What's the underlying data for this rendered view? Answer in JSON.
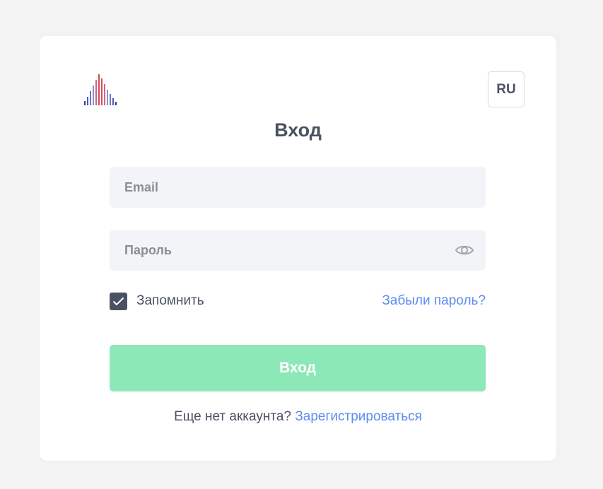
{
  "header": {
    "language": "RU",
    "title": "Вход"
  },
  "form": {
    "email": {
      "value": "",
      "placeholder": "Email"
    },
    "password": {
      "value": "",
      "placeholder": "Пароль",
      "toggle_icon": "eye-icon"
    },
    "remember": {
      "label": "Запомнить",
      "checked": true
    },
    "forgot_label": "Забыли пароль?",
    "submit_label": "Вход"
  },
  "footer": {
    "prompt": "Еще нет аккаунта?",
    "register_label": "Зарегистрироваться"
  },
  "colors": {
    "background": "#f3f3f4",
    "card": "#ffffff",
    "text": "#4a5163",
    "link": "#5b8def",
    "button": "#8de8b8",
    "input": "#f3f4f8",
    "logo_red": "#d94a5a",
    "logo_blue": "#6b77cf",
    "logo_dark": "#2e3d9a"
  }
}
